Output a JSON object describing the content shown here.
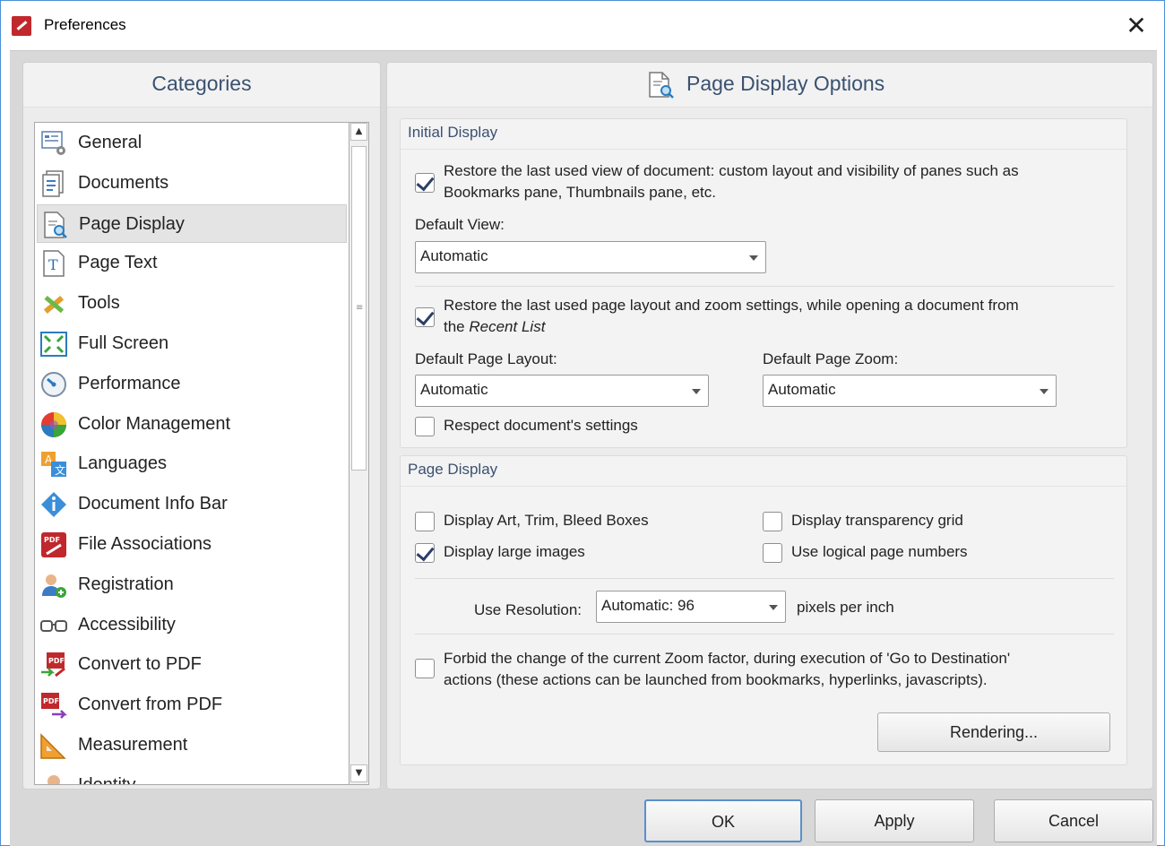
{
  "window": {
    "title": "Preferences",
    "close_icon": "close-icon"
  },
  "categories": {
    "header": "Categories",
    "items": [
      {
        "label": "General",
        "icon": "general-settings-icon"
      },
      {
        "label": "Documents",
        "icon": "documents-icon"
      },
      {
        "label": "Page Display",
        "icon": "page-display-icon",
        "selected": true
      },
      {
        "label": "Page Text",
        "icon": "page-text-icon"
      },
      {
        "label": "Tools",
        "icon": "tools-icon"
      },
      {
        "label": "Full Screen",
        "icon": "full-screen-icon"
      },
      {
        "label": "Performance",
        "icon": "performance-icon"
      },
      {
        "label": "Color Management",
        "icon": "color-management-icon"
      },
      {
        "label": "Languages",
        "icon": "languages-icon"
      },
      {
        "label": "Document Info Bar",
        "icon": "info-icon"
      },
      {
        "label": "File Associations",
        "icon": "pdf-icon"
      },
      {
        "label": "Registration",
        "icon": "registration-icon"
      },
      {
        "label": "Accessibility",
        "icon": "glasses-icon"
      },
      {
        "label": "Convert to PDF",
        "icon": "convert-to-pdf-icon"
      },
      {
        "label": "Convert from PDF",
        "icon": "convert-from-pdf-icon"
      },
      {
        "label": "Measurement",
        "icon": "measurement-icon"
      },
      {
        "label": "Identity",
        "icon": "identity-icon"
      }
    ]
  },
  "options": {
    "header": "Page Display Options",
    "initial_display": {
      "title": "Initial Display",
      "restore_view": {
        "checked": true,
        "line1": "Restore the last used view of document: custom layout and visibility of panes such as",
        "line2": "Bookmarks pane, Thumbnails pane, etc."
      },
      "default_view_label": "Default View:",
      "default_view_value": "Automatic",
      "restore_layout": {
        "checked": true,
        "line1": "Restore the last used page layout and zoom settings, while opening a document from",
        "line2_prefix": "the",
        "line2_italic": "Recent List"
      },
      "default_page_layout_label": "Default Page Layout:",
      "default_page_layout_value": "Automatic",
      "default_page_zoom_label": "Default Page Zoom:",
      "default_page_zoom_value": "Automatic",
      "respect_settings": {
        "checked": false,
        "label": "Respect document's settings"
      }
    },
    "page_display": {
      "title": "Page Display",
      "display_boxes": {
        "checked": false,
        "label": "Display Art, Trim, Bleed Boxes"
      },
      "display_transparency": {
        "checked": false,
        "label": "Display transparency grid"
      },
      "display_large_images": {
        "checked": true,
        "label": "Display large images"
      },
      "logical_page_numbers": {
        "checked": false,
        "label": "Use logical page numbers"
      },
      "resolution_label": "Use Resolution:",
      "resolution_value": "Automatic: 96",
      "resolution_unit": "pixels per inch",
      "forbid_zoom": {
        "checked": false,
        "line1": "Forbid the change of the current Zoom factor, during execution of 'Go to Destination'",
        "line2": "actions (these actions can be launched from bookmarks, hyperlinks, javascripts)."
      },
      "rendering_button": "Rendering..."
    }
  },
  "footer": {
    "ok": "OK",
    "apply": "Apply",
    "cancel": "Cancel"
  }
}
